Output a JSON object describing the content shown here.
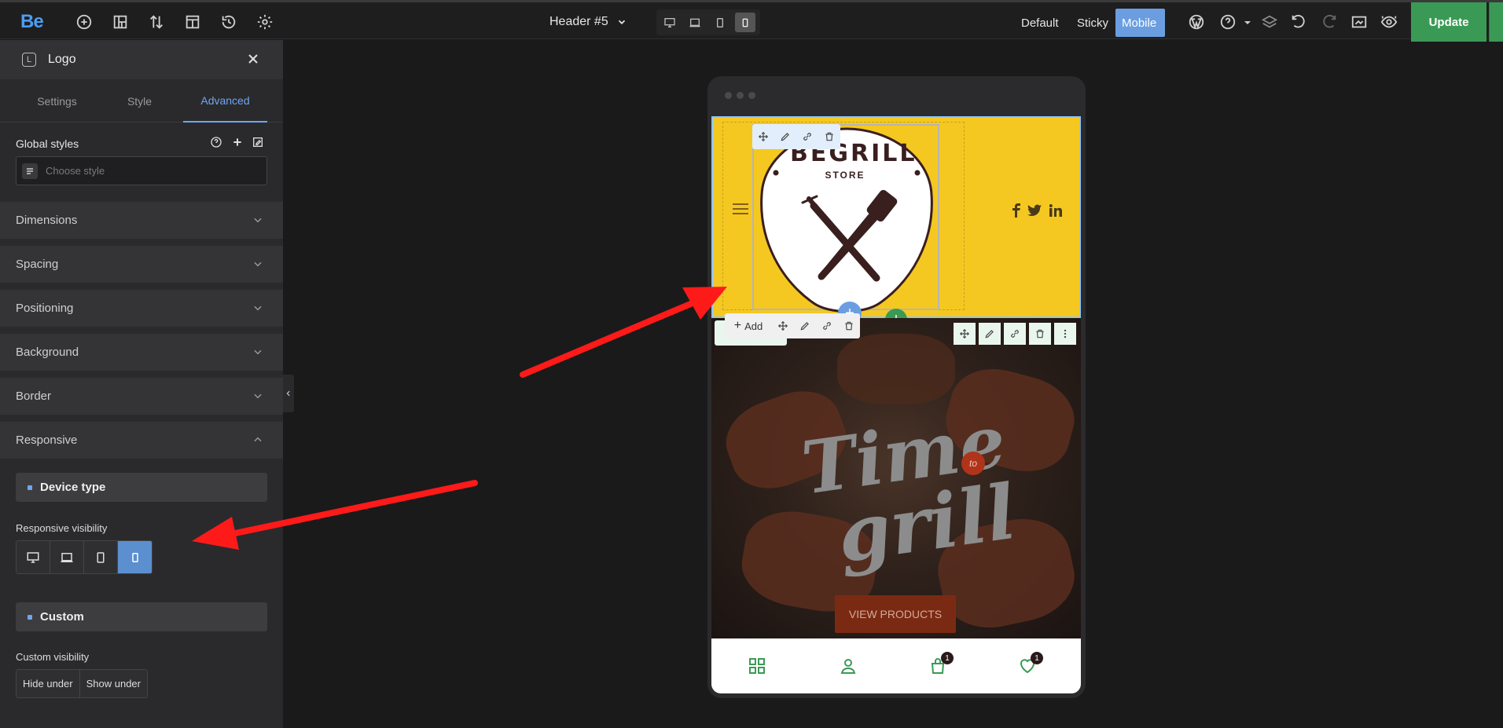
{
  "topbar": {
    "brand": "Be",
    "icons": [
      "plus-circle-icon",
      "layout-icon",
      "sort-icon",
      "template-icon",
      "history-icon",
      "gear-icon"
    ],
    "header_name": "Header #5",
    "devices": [
      "desktop",
      "laptop",
      "tablet",
      "mobile"
    ],
    "active_device": "mobile",
    "modes": [
      "Default",
      "Sticky",
      "Mobile"
    ],
    "active_mode": "Mobile",
    "right_icons": [
      "wordpress-icon",
      "help-icon",
      "layers-icon",
      "undo-icon",
      "redo-icon",
      "preview-icon",
      "eye-icon"
    ],
    "update_label": "Update"
  },
  "sidebar": {
    "element_title": "Logo",
    "element_icon_letter": "L",
    "tabs": [
      "Settings",
      "Style",
      "Advanced"
    ],
    "active_tab": "Advanced",
    "global_styles_label": "Global styles",
    "choose_style_placeholder": "Choose style",
    "sections": [
      "Dimensions",
      "Spacing",
      "Positioning",
      "Background",
      "Border",
      "Responsive"
    ],
    "responsive": {
      "device_type_label": "Device type",
      "visibility_label": "Responsive visibility",
      "active_device": "mobile",
      "custom_label": "Custom",
      "custom_visibility_label": "Custom visibility",
      "hide_under": "Hide under",
      "show_under": "Show under"
    }
  },
  "canvas": {
    "logo_text": "BEGRILL",
    "logo_sub": "STORE",
    "add_label": "Add",
    "hero_script_1": "Time",
    "hero_script_2": "grill",
    "hero_badge": "to",
    "cta": "VIEW PRODUCTS",
    "cart_count": "1",
    "wishlist_count": "1",
    "colors": {
      "header_bg": "#f5c821",
      "accent": "#3a9a55",
      "cta": "#7a2a13"
    }
  }
}
